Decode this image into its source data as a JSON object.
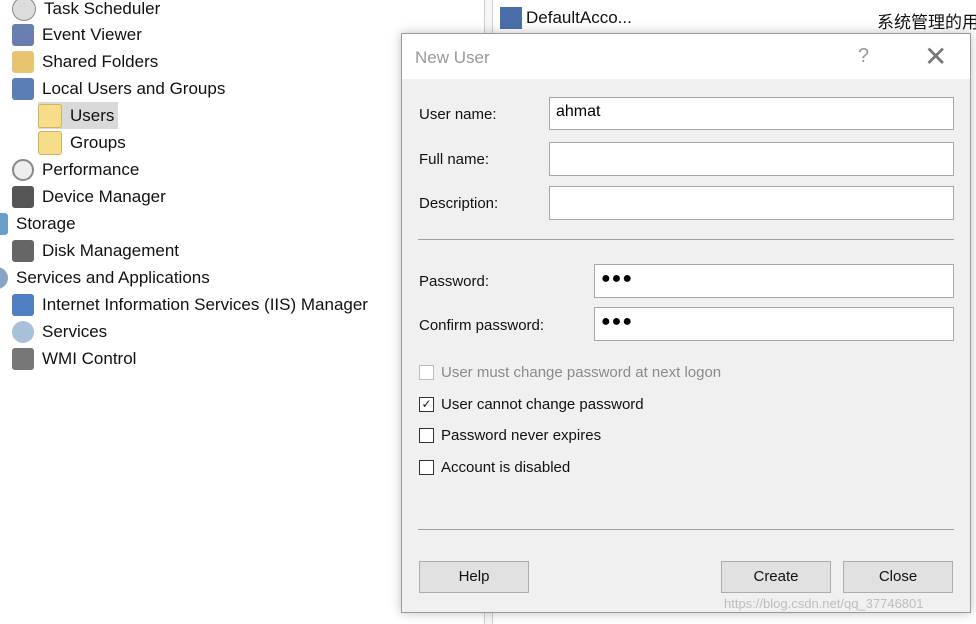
{
  "tree": {
    "items": [
      {
        "label": "Task Scheduler",
        "icon": "clock-icon"
      },
      {
        "label": "Event Viewer",
        "icon": "event-viewer-icon"
      },
      {
        "label": "Shared Folders",
        "icon": "shared-folder-icon"
      },
      {
        "label": "Local Users and Groups",
        "icon": "users-icon"
      },
      {
        "label": "Users",
        "icon": "folder-icon",
        "selected": true
      },
      {
        "label": "Groups",
        "icon": "folder-icon"
      },
      {
        "label": "Performance",
        "icon": "performance-icon"
      },
      {
        "label": "Device Manager",
        "icon": "device-manager-icon"
      },
      {
        "label": "Storage",
        "icon": "storage-icon"
      },
      {
        "label": "Disk Management",
        "icon": "disk-icon"
      },
      {
        "label": "Services and Applications",
        "icon": "gear-icon"
      },
      {
        "label": "Internet Information Services (IIS) Manager",
        "icon": "iis-icon"
      },
      {
        "label": "Services",
        "icon": "gear-icon"
      },
      {
        "label": "WMI Control",
        "icon": "wmi-icon"
      }
    ]
  },
  "list": {
    "row_name": "DefaultAcco...",
    "row_desc": "系统管理的用"
  },
  "dialog": {
    "title": "New User",
    "help": "?",
    "close": "✕",
    "username_label": "User name:",
    "username_value": "ahmat",
    "fullname_label": "Full name:",
    "fullname_value": "",
    "description_label": "Description:",
    "description_value": "",
    "password_label": "Password:",
    "password_value": "●●●",
    "confirm_label": "Confirm password:",
    "confirm_value": "●●●",
    "checkboxes": [
      {
        "label": "User must change password at next logon",
        "checked": false,
        "disabled": true
      },
      {
        "label": "User cannot change password",
        "checked": true,
        "disabled": false
      },
      {
        "label": "Password never expires",
        "checked": false,
        "disabled": false
      },
      {
        "label": "Account is disabled",
        "checked": false,
        "disabled": false
      }
    ],
    "help_button": "Help",
    "create_button": "Create",
    "close_button": "Close"
  },
  "watermark": "https://blog.csdn.net/qq_37746801"
}
